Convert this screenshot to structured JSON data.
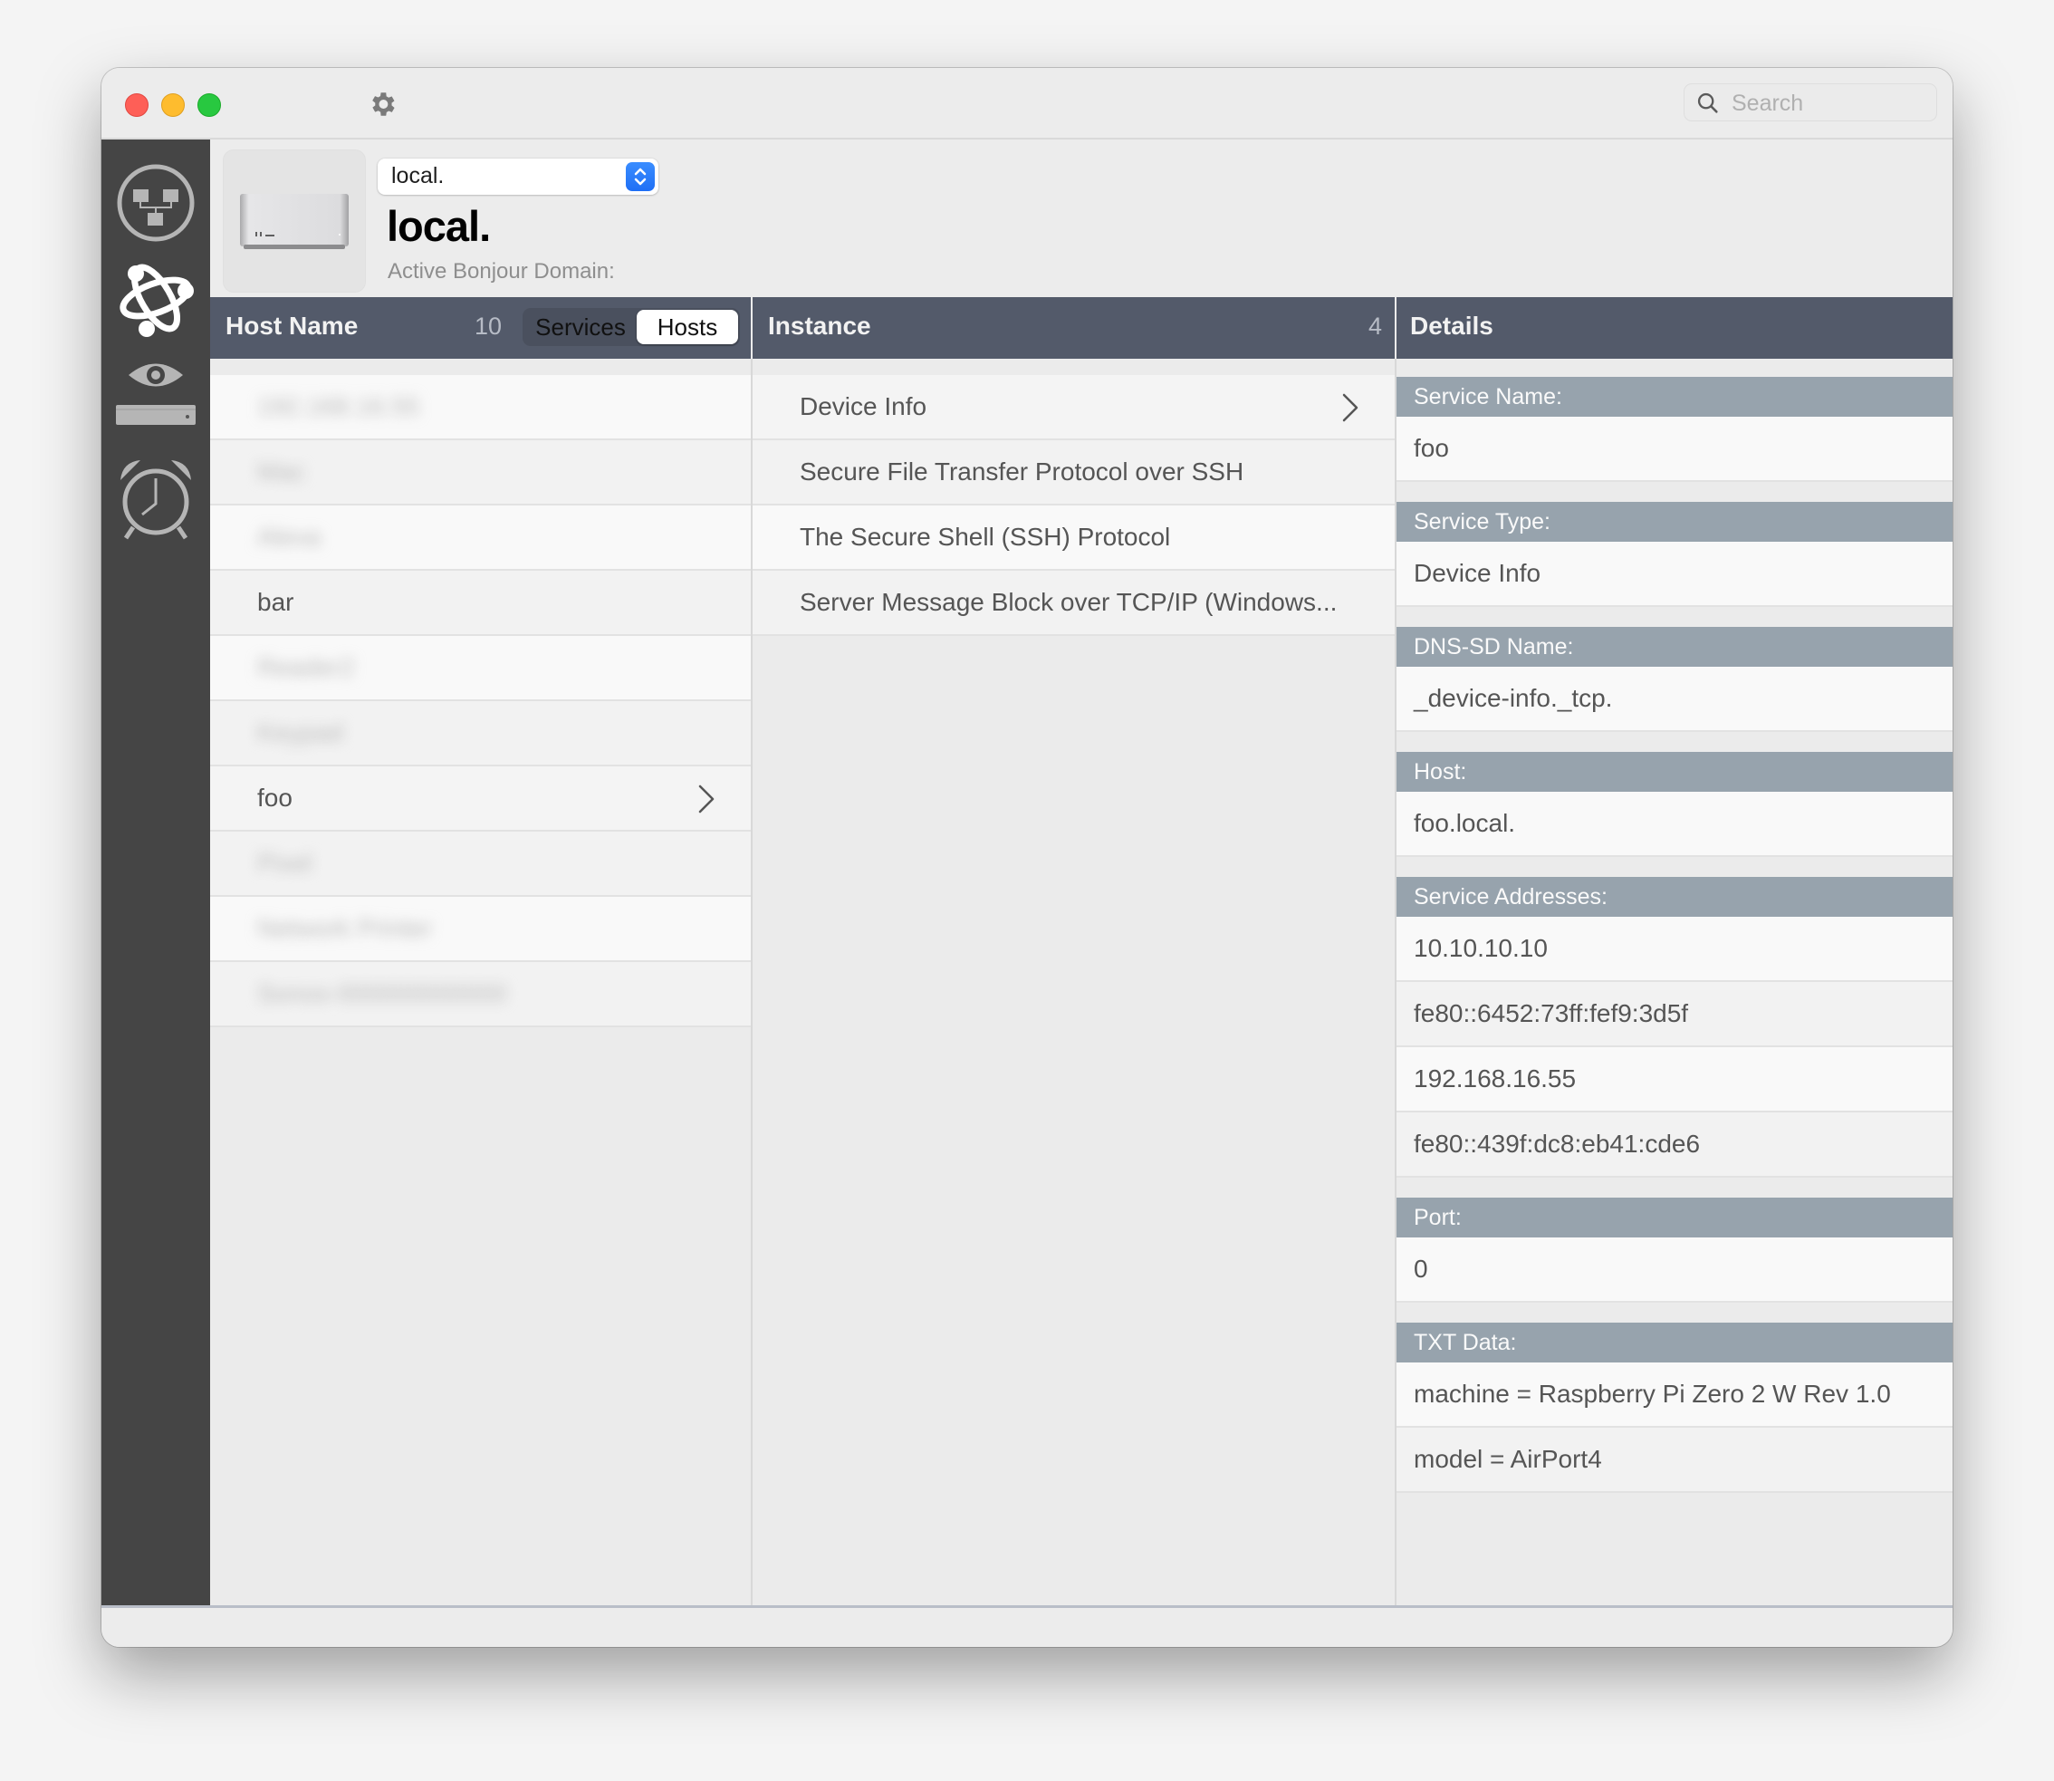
{
  "window": {
    "traffic_lights": [
      "close",
      "minimize",
      "zoom"
    ],
    "settings_icon": "gear-icon",
    "search": {
      "placeholder": "Search",
      "value": ""
    }
  },
  "sidebar": {
    "items": [
      {
        "name": "network-topology",
        "icon": "network-icon"
      },
      {
        "name": "bonjour-services",
        "icon": "bonjour-icon",
        "selected": true
      },
      {
        "name": "device-monitor",
        "icon": "eye-device-icon"
      },
      {
        "name": "alarm",
        "icon": "alarm-clock-icon"
      }
    ]
  },
  "header": {
    "domain_popup_value": "local.",
    "domain_title": "local.",
    "domain_subtitle": "Active Bonjour Domain:"
  },
  "hosts_column": {
    "title": "Host Name",
    "count": "10",
    "segmented": {
      "options": [
        "Services",
        "Hosts"
      ],
      "selected": "Hosts"
    },
    "rows": [
      {
        "label": "192.168.16.55",
        "blurred": true
      },
      {
        "label": "Mac",
        "blurred": true
      },
      {
        "label": "Alexa",
        "blurred": true
      },
      {
        "label": "bar",
        "blurred": false
      },
      {
        "label": "Reader2",
        "blurred": true
      },
      {
        "label": "Keypad",
        "blurred": true
      },
      {
        "label": "foo",
        "blurred": false,
        "selected": true
      },
      {
        "label": "Pixel",
        "blurred": true
      },
      {
        "label": "Network Printer",
        "blurred": true
      },
      {
        "label": "Sonos-000000000000",
        "blurred": true
      }
    ]
  },
  "instance_column": {
    "title": "Instance",
    "count": "4",
    "rows": [
      {
        "label": "Device Info",
        "selected": true
      },
      {
        "label": "Secure File Transfer Protocol over SSH"
      },
      {
        "label": "The Secure Shell (SSH) Protocol"
      },
      {
        "label": "Server Message Block over TCP/IP (Windows..."
      }
    ]
  },
  "details_column": {
    "title": "Details",
    "groups": [
      {
        "label": "Service Name:",
        "values": [
          "foo"
        ]
      },
      {
        "label": "Service Type:",
        "values": [
          "Device Info"
        ]
      },
      {
        "label": "DNS-SD Name:",
        "values": [
          "_device-info._tcp."
        ]
      },
      {
        "label": "Host:",
        "values": [
          "foo.local."
        ]
      },
      {
        "label": "Service Addresses:",
        "values": [
          "10.10.10.10",
          "fe80::6452:73ff:fef9:3d5f",
          "192.168.16.55",
          "fe80::439f:dc8:eb41:cde6"
        ]
      },
      {
        "label": "Port:",
        "values": [
          "0"
        ]
      },
      {
        "label": "TXT Data:",
        "values": [
          "machine = Raspberry Pi Zero 2 W Rev 1.0",
          "model = AirPort4"
        ]
      }
    ]
  },
  "colors": {
    "column_header_bg": "#535a6a",
    "detail_label_bg": "#97a3ad",
    "sidebar_bg": "#454545",
    "accent": "#1f6ff5"
  }
}
